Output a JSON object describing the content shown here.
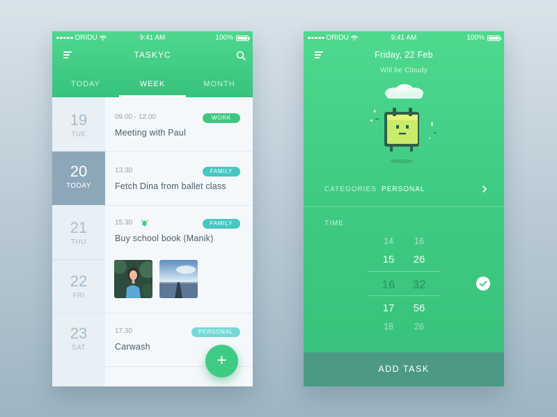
{
  "status": {
    "carrier": "ORIDU",
    "time": "9:41 AM",
    "battery": "100%"
  },
  "left": {
    "title": "TASKYC",
    "tabs": [
      {
        "label": "TODAY",
        "active": false
      },
      {
        "label": "WEEK",
        "active": true
      },
      {
        "label": "MONTH",
        "active": false
      }
    ],
    "dates": [
      {
        "num": "19",
        "day": "TUE"
      },
      {
        "num": "20",
        "day": "TODAY"
      },
      {
        "num": "21",
        "day": "THU"
      },
      {
        "num": "22",
        "day": "FRI"
      },
      {
        "num": "23",
        "day": "SAT"
      }
    ],
    "tasks": [
      {
        "time": "09.00 - 12.00",
        "title": "Meeting with Paul",
        "tag": "WORK"
      },
      {
        "time": "13.30",
        "title": "Fetch Dina from ballet class",
        "tag": "FAMILY"
      },
      {
        "time": "15.30",
        "title": "Buy school book (Manik)",
        "tag": "FAMILY"
      },
      {
        "time": "17.30",
        "title": "Carwash",
        "tag": "PERSONAL"
      }
    ],
    "fab_label": "+"
  },
  "right": {
    "date": "Friday, 22 Feb",
    "weather": "Will be Cloudy",
    "categories_label": "CATEGORIES",
    "category_value": "PERSONAL",
    "time_label": "TIME",
    "picker": [
      {
        "h": "14",
        "m": "16"
      },
      {
        "h": "15",
        "m": "26"
      },
      {
        "h": "16",
        "m": "32"
      },
      {
        "h": "17",
        "m": "56"
      },
      {
        "h": "18",
        "m": "26"
      }
    ],
    "add_task_label": "ADD TASK"
  },
  "colors": {
    "green": "#3fcb83",
    "selected_date": "#8ca7b8",
    "tag_family": "#43c8c3",
    "add_task_bar": "#4c9a86"
  },
  "icons": [
    "menu-icon",
    "search-icon",
    "alarm-icon",
    "chevron-right-icon",
    "check-icon",
    "wifi-icon",
    "battery-icon",
    "calendar-mascot-icon",
    "cloud-icon"
  ]
}
